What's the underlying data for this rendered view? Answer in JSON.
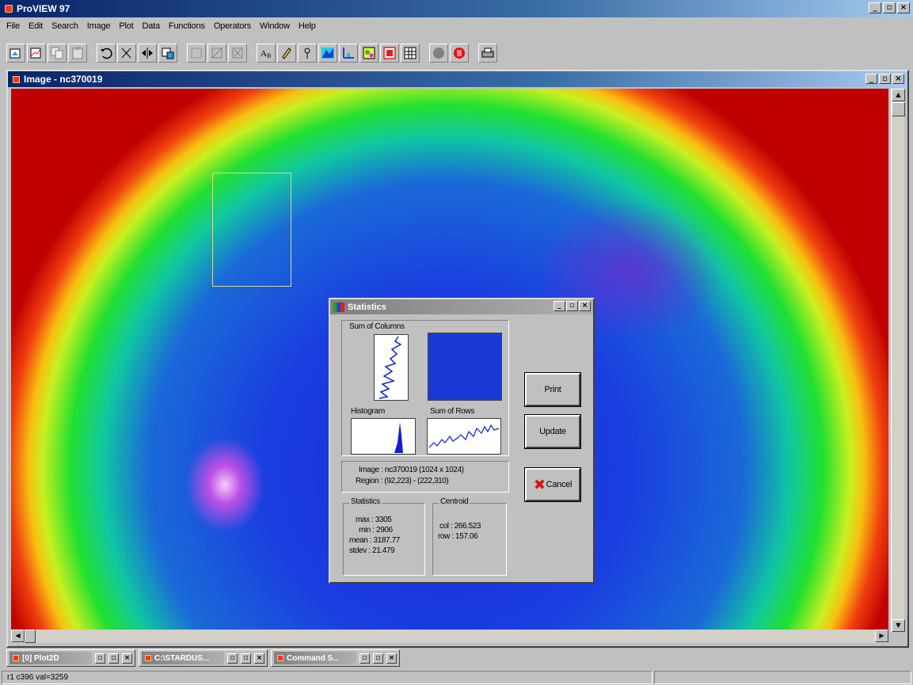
{
  "app": {
    "title": "ProVIEW 97",
    "window_controls": {
      "minimize": "_",
      "maximize": "▫",
      "close": "×"
    }
  },
  "menu": [
    "File",
    "Edit",
    "Search",
    "Image",
    "Plot",
    "Data",
    "Functions",
    "Operators",
    "Window",
    "Help"
  ],
  "toolbar": {
    "icons": [
      "open-image-icon",
      "open-plot-icon",
      "copy-icon",
      "paste-icon",
      "undo-icon",
      "cut-icon",
      "flip-icon",
      "zoom-icon",
      "select-icon",
      "rotate-icon",
      "filter-icon",
      "text-icon",
      "pencil-icon",
      "probe-icon",
      "surface-plot-icon",
      "line-plot-icon",
      "palette-icon",
      "table-icon",
      "grid-icon",
      "record-icon",
      "stop-icon",
      "print-icon"
    ]
  },
  "image_window": {
    "title": "Image - nc370019",
    "colors": {
      "blue": "#1d2ad8",
      "green": "#22e030",
      "yellow": "#f8c010",
      "red": "#c00000",
      "magenta": "#e650e6"
    }
  },
  "stats_dialog": {
    "title": "Statistics",
    "sum_of_columns_label": "Sum of Columns",
    "histogram_label": "Histogram",
    "sum_of_rows_label": "Sum of Rows",
    "image_line": "Image : nc370019 (1024 x 1024)",
    "region_line": "Region : (92,223) - (222,310)",
    "statistics_group_label": "Statistics",
    "centroid_group_label": "Centroid",
    "stats": {
      "max": "max : 3305",
      "min": "min : 2906",
      "mean": "mean : 3187.77",
      "stdev": "stdev : 21.479"
    },
    "centroid": {
      "col": "col : 266.523",
      "row": "row : 157.06"
    },
    "buttons": {
      "print": "Print",
      "update": "Update",
      "cancel": "Cancel"
    }
  },
  "taskbar": [
    {
      "label": "[0] Plot2D"
    },
    {
      "label": "C:\\STARDUS..."
    },
    {
      "label": "Command S..."
    }
  ],
  "status": {
    "position": "r1  c396  val=3259"
  }
}
